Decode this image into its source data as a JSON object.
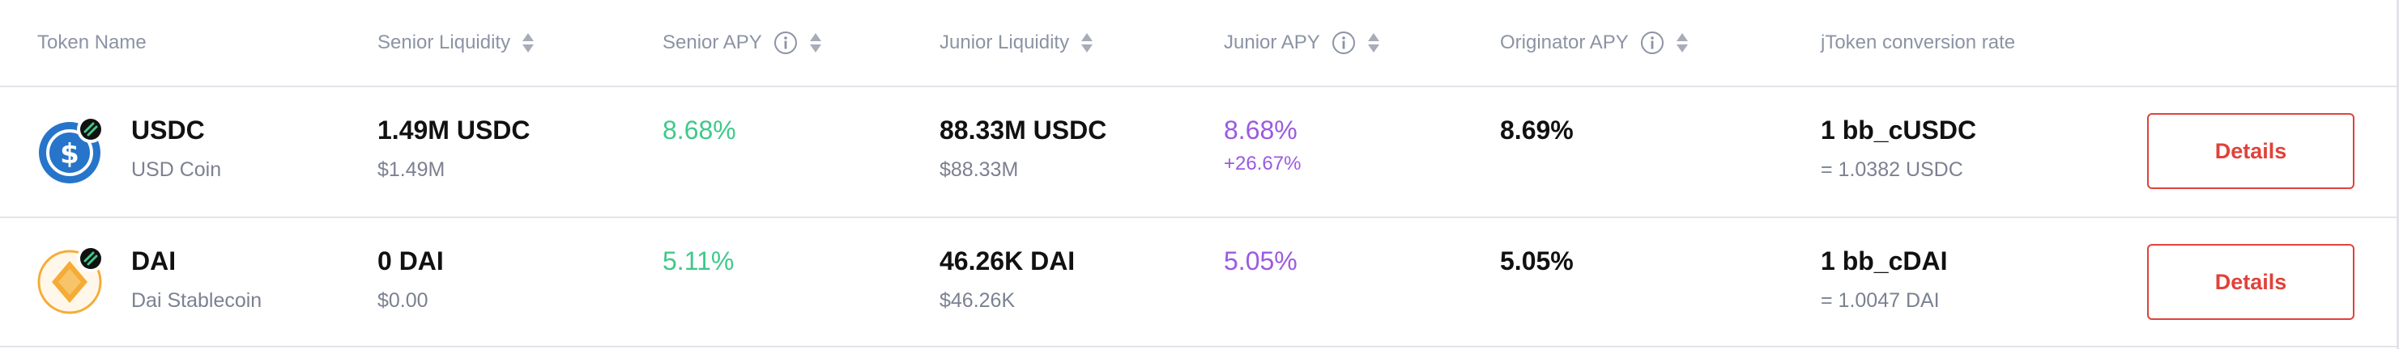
{
  "columns": {
    "token_name": "Token Name",
    "senior_liquidity": "Senior Liquidity",
    "senior_apy": "Senior APY",
    "junior_liquidity": "Junior Liquidity",
    "junior_apy": "Junior APY",
    "originator_apy": "Originator APY",
    "conversion_rate": "jToken conversion rate"
  },
  "rows": [
    {
      "symbol": "USDC",
      "name": "USD Coin",
      "senior_liquidity": "1.49M USDC",
      "senior_liquidity_usd": "$1.49M",
      "senior_apy": "8.68%",
      "junior_liquidity": "88.33M USDC",
      "junior_liquidity_usd": "$88.33M",
      "junior_apy": "8.68%",
      "junior_apy_bonus": "+26.67%",
      "originator_apy": "8.69%",
      "conversion": "1 bb_cUSDC",
      "conversion_rate": "= 1.0382 USDC",
      "button": "Details",
      "icon": "usdc-icon"
    },
    {
      "symbol": "DAI",
      "name": "Dai Stablecoin",
      "senior_liquidity": "0 DAI",
      "senior_liquidity_usd": "$0.00",
      "senior_apy": "5.11%",
      "junior_liquidity": "46.26K DAI",
      "junior_liquidity_usd": "$46.26K",
      "junior_apy": "5.05%",
      "junior_apy_bonus": "",
      "originator_apy": "5.05%",
      "conversion": "1 bb_cDAI",
      "conversion_rate": "= 1.0047 DAI",
      "button": "Details",
      "icon": "dai-icon"
    }
  ],
  "colors": {
    "header_text": "#8c93a4",
    "senior_apy": "#3fc98a",
    "junior_apy": "#9b5ae0",
    "button": "#e0423a",
    "usdc_blue": "#2775ca",
    "dai_gold": "#f5ac37"
  }
}
